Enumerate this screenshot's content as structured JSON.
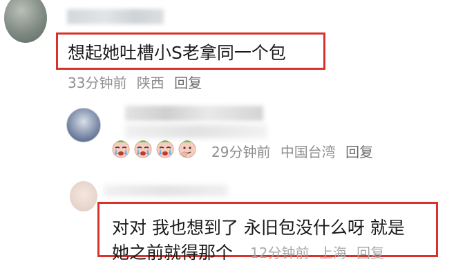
{
  "comment": {
    "text": "想起她吐槽小S老拿同一个包",
    "time": "33分钟前",
    "location": "陕西",
    "reply_label": "回复"
  },
  "reply1": {
    "emojis": [
      "crying-face",
      "crying-face",
      "crying-face",
      "thinking-face"
    ],
    "time": "29分钟前",
    "location": "中国台湾",
    "reply_label": "回复"
  },
  "reply2": {
    "line1": "对对 我也想到了 永旧包没什么呀 就是",
    "line2": "她之前就得那个",
    "time": "12分钟前",
    "location": "上海",
    "reply_label": "回复"
  },
  "colors": {
    "highlight": "#d9312b",
    "text": "#1a1a1a",
    "meta": "#8e8e8e"
  }
}
